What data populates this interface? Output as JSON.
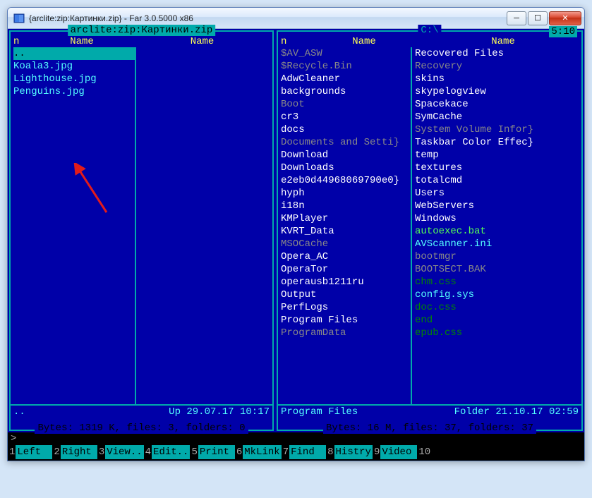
{
  "window": {
    "title": "{arclite:zip:Картинки.zip} - Far 3.0.5000 x86"
  },
  "clock": "5:10",
  "left_panel": {
    "title": "arclite:zip:Картинки.zip",
    "header_n": "n",
    "header_name1": "Name",
    "header_name2": "Name",
    "items_col1": [
      {
        "text": "..",
        "cls": "selected"
      },
      {
        "text": "Koala3.jpg",
        "cls": ""
      },
      {
        "text": "Lighthouse.jpg",
        "cls": ""
      },
      {
        "text": "Penguins.jpg",
        "cls": ""
      }
    ],
    "footer_name": "..",
    "footer_attr": "Up   29.07.17 10:17",
    "status": " Bytes: 1319 K, files: 3, folders: 0 "
  },
  "right_panel": {
    "title": "C:\\",
    "header_n": "n",
    "header_name1": "Name",
    "header_name2": "Name",
    "items_col1": [
      {
        "text": "$AV_ASW",
        "cls": "dim"
      },
      {
        "text": "$Recycle.Bin",
        "cls": "dim"
      },
      {
        "text": "AdwCleaner",
        "cls": "white"
      },
      {
        "text": "backgrounds",
        "cls": "white"
      },
      {
        "text": "Boot",
        "cls": "dim"
      },
      {
        "text": "cr3",
        "cls": "white"
      },
      {
        "text": "docs",
        "cls": "white"
      },
      {
        "text": "Documents and Setti}",
        "cls": "dim"
      },
      {
        "text": "Download",
        "cls": "white"
      },
      {
        "text": "Downloads",
        "cls": "white"
      },
      {
        "text": "e2eb0d44968069790e0}",
        "cls": "white"
      },
      {
        "text": "hyph",
        "cls": "white"
      },
      {
        "text": "i18n",
        "cls": "white"
      },
      {
        "text": "KMPlayer",
        "cls": "white"
      },
      {
        "text": "KVRT_Data",
        "cls": "white"
      },
      {
        "text": "MSOCache",
        "cls": "dim"
      },
      {
        "text": "Opera_AC",
        "cls": "white"
      },
      {
        "text": "OperaTor",
        "cls": "white"
      },
      {
        "text": "operausb1211ru",
        "cls": "white"
      },
      {
        "text": "Output",
        "cls": "white"
      },
      {
        "text": "PerfLogs",
        "cls": "white"
      },
      {
        "text": "Program Files",
        "cls": "white"
      },
      {
        "text": "ProgramData",
        "cls": "dim"
      }
    ],
    "items_col2": [
      {
        "text": "Recovered Files",
        "cls": "white"
      },
      {
        "text": "Recovery",
        "cls": "dim"
      },
      {
        "text": "skins",
        "cls": "white"
      },
      {
        "text": "skypelogview",
        "cls": "white"
      },
      {
        "text": "Spacekace",
        "cls": "white"
      },
      {
        "text": "SymCache",
        "cls": "white"
      },
      {
        "text": "System Volume Infor}",
        "cls": "dim"
      },
      {
        "text": "Taskbar Color Effec}",
        "cls": "white"
      },
      {
        "text": "temp",
        "cls": "white"
      },
      {
        "text": "textures",
        "cls": "white"
      },
      {
        "text": "totalcmd",
        "cls": "white"
      },
      {
        "text": "Users",
        "cls": "white"
      },
      {
        "text": "WebServers",
        "cls": "white"
      },
      {
        "text": "Windows",
        "cls": "white"
      },
      {
        "text": "autoexec.bat",
        "cls": "green"
      },
      {
        "text": "AVScanner.ini",
        "cls": ""
      },
      {
        "text": "bootmgr",
        "cls": "dim"
      },
      {
        "text": "BOOTSECT.BAK",
        "cls": "dim"
      },
      {
        "text": "chm.css",
        "cls": "darkgreen"
      },
      {
        "text": "config.sys",
        "cls": ""
      },
      {
        "text": "doc.css",
        "cls": "darkgreen"
      },
      {
        "text": "end",
        "cls": "darkgreen"
      },
      {
        "text": "epub.css",
        "cls": "darkgreen"
      }
    ],
    "footer_name": "Program Files",
    "footer_attr": "Folder 21.10.17 02:59",
    "status": " Bytes: 16 M, files: 37, folders: 37 "
  },
  "cmd_prompt": ">",
  "fn_keys": [
    {
      "num": "1",
      "label": "Left  "
    },
    {
      "num": "2",
      "label": "Right "
    },
    {
      "num": "3",
      "label": "View.."
    },
    {
      "num": "4",
      "label": "Edit.."
    },
    {
      "num": "5",
      "label": "Print "
    },
    {
      "num": "6",
      "label": "MkLink"
    },
    {
      "num": "7",
      "label": "Find  "
    },
    {
      "num": "8",
      "label": "Histry"
    },
    {
      "num": "9",
      "label": "Video "
    },
    {
      "num": "10",
      "label": "      "
    }
  ]
}
